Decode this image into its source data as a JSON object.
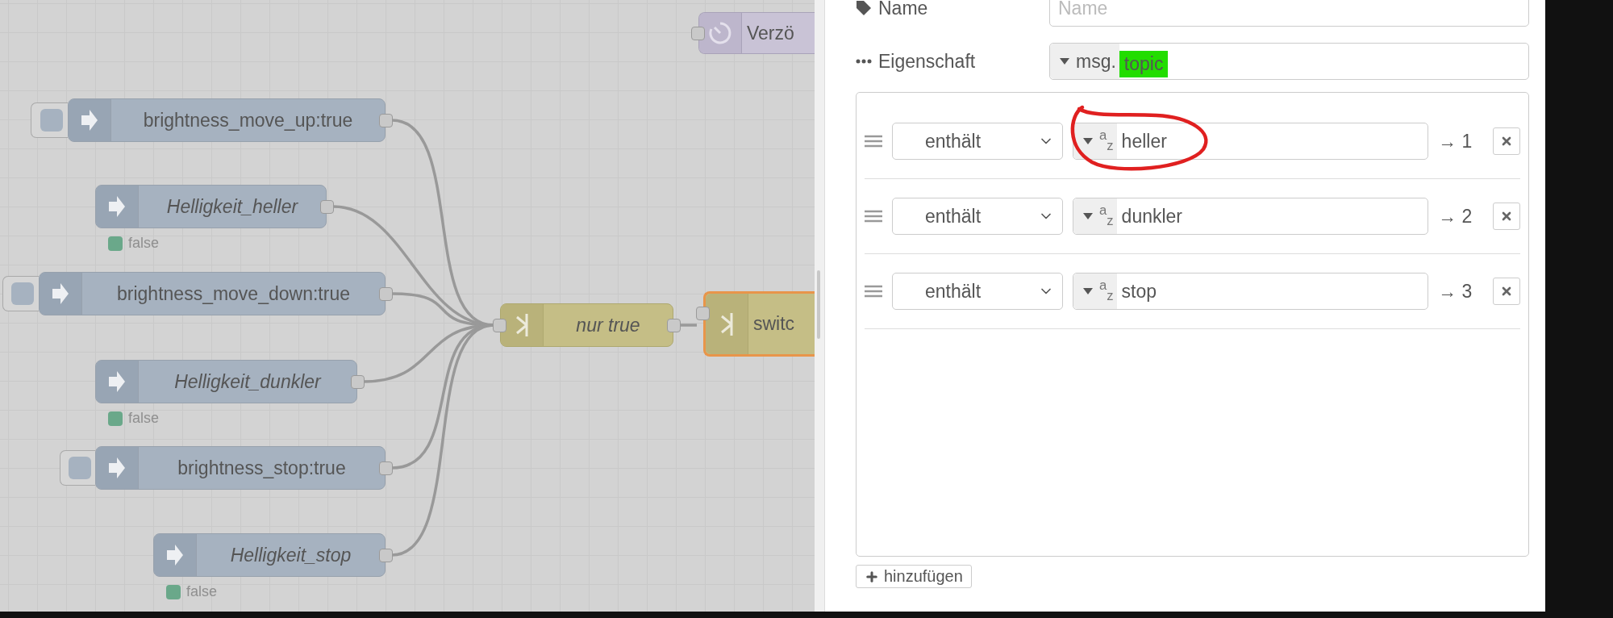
{
  "canvas": {
    "nodes": [
      {
        "kind": "delay",
        "label": "Verzö",
        "italic": false,
        "selected": false
      },
      {
        "kind": "inject",
        "label": "brightness_move_up:true",
        "italic": false,
        "selected": false,
        "has_button": true
      },
      {
        "kind": "inject",
        "label": "Helligkeit_heller",
        "italic": true,
        "selected": false,
        "has_button": false,
        "status": {
          "text": "false",
          "color": "#6aa88a"
        }
      },
      {
        "kind": "inject",
        "label": "brightness_move_down:true",
        "italic": false,
        "selected": false,
        "has_button": true
      },
      {
        "kind": "inject",
        "label": "Helligkeit_dunkler",
        "italic": true,
        "selected": false,
        "has_button": false,
        "status": {
          "text": "false",
          "color": "#6aa88a"
        }
      },
      {
        "kind": "inject",
        "label": "brightness_stop:true",
        "italic": false,
        "selected": false,
        "has_button": true
      },
      {
        "kind": "inject",
        "label": "Helligkeit_stop",
        "italic": true,
        "selected": false,
        "has_button": false,
        "status": {
          "text": "false",
          "color": "#6aa88a"
        }
      },
      {
        "kind": "switch",
        "label": "nur true",
        "italic": true,
        "selected": false
      },
      {
        "kind": "switch",
        "label": "switc",
        "italic": false,
        "selected": true
      }
    ]
  },
  "editor": {
    "name": {
      "label": "Name",
      "placeholder": "Name"
    },
    "property": {
      "label": "Eigenschaft",
      "prefix": "msg.",
      "value": "topic",
      "highlighted": true
    },
    "rules": [
      {
        "operator": "enthält",
        "type_glyph": "$^{a}$$_{z}$",
        "value": "heller",
        "output": "→ 1",
        "circled": true
      },
      {
        "operator": "enthält",
        "type_glyph": "$^{a}$$_{z}$",
        "value": "dunkler",
        "output": "→ 2",
        "circled": false
      },
      {
        "operator": "enthält",
        "type_glyph": "$^{a}$$_{z}$",
        "value": "stop",
        "output": "→ 3",
        "circled": false
      }
    ],
    "add_button": "hinzufügen"
  }
}
